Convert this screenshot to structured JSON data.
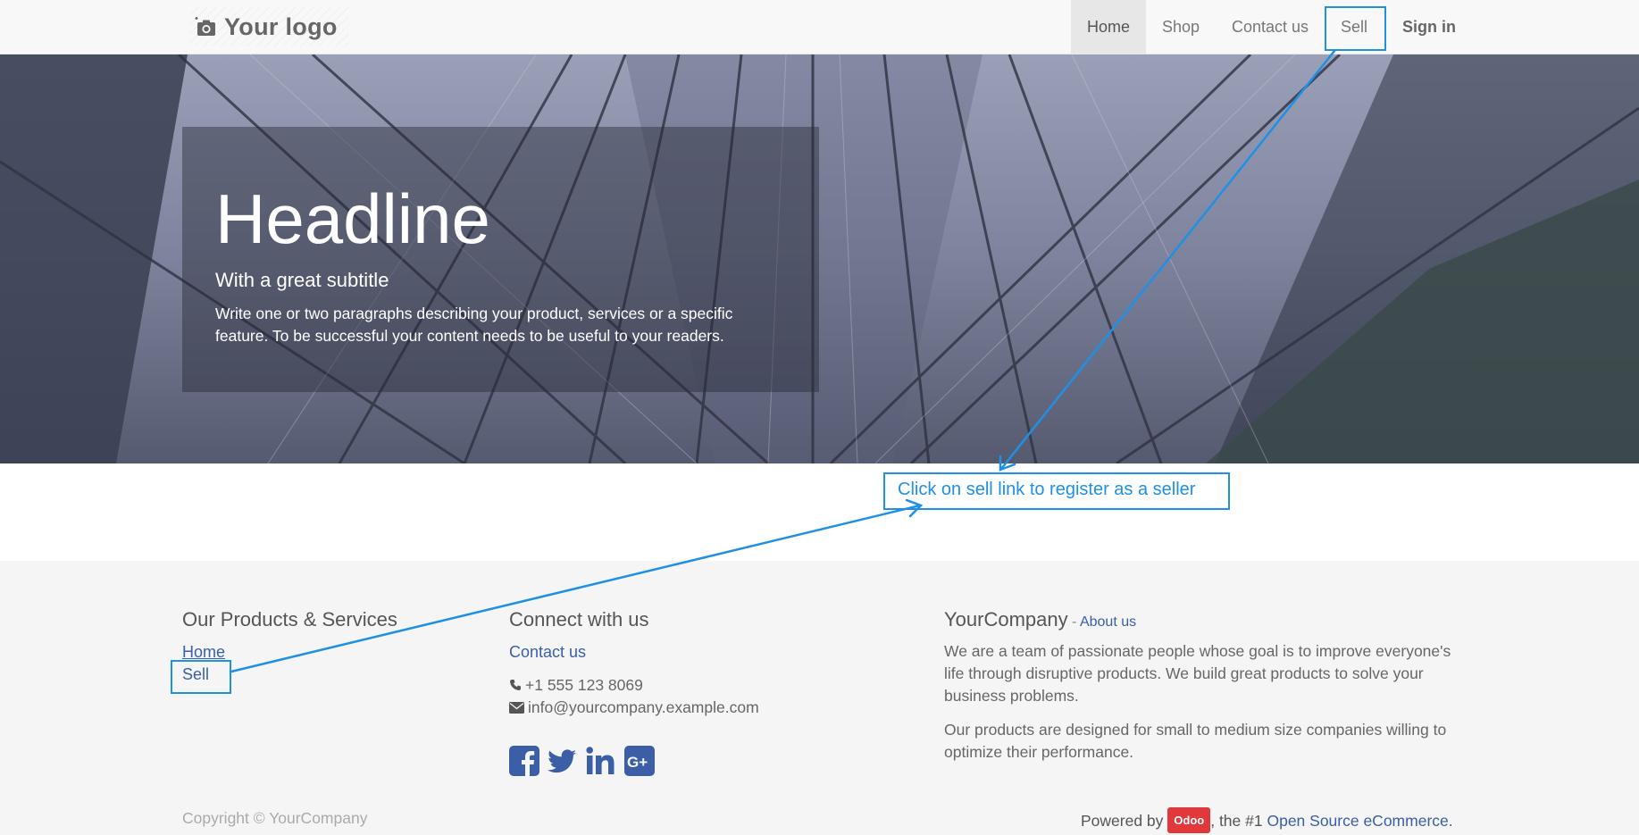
{
  "navbar": {
    "logo_text": "Your logo",
    "items": [
      {
        "label": "Home"
      },
      {
        "label": "Shop"
      },
      {
        "label": "Contact us"
      },
      {
        "label": "Sell"
      },
      {
        "label": "Sign in"
      }
    ]
  },
  "hero": {
    "headline": "Headline",
    "subtitle": "With a great subtitle",
    "paragraph": "Write one or two paragraphs describing your product, services or a specific feature. To be successful your content needs to be useful to your readers."
  },
  "annotation": {
    "label": "Click on sell link to register as a seller",
    "color": "#1e90e6"
  },
  "footer": {
    "products": {
      "heading": "Our Products & Services",
      "links": [
        "Home",
        "Sell"
      ]
    },
    "connect": {
      "heading": "Connect with us",
      "contact_link": "Contact us",
      "phone": "+1 555 123 8069",
      "email": "info@yourcompany.example.com",
      "social_icons": [
        "facebook-icon",
        "twitter-icon",
        "linkedin-icon",
        "google-plus-icon"
      ]
    },
    "company": {
      "name": "YourCompany",
      "separator": " - ",
      "about_link": "About us",
      "para1": "We are a team of passionate people whose goal is to improve everyone's life through disruptive products. We build great products to solve your business problems.",
      "para2": "Our products are designed for small to medium size companies willing to optimize their performance."
    },
    "copyright": "Copyright © YourCompany",
    "powered_prefix": "Powered by ",
    "powered_badge": "Odoo",
    "powered_middle": ", the #1 ",
    "powered_link": "Open Source eCommerce",
    "powered_suffix": "."
  },
  "colors": {
    "link": "#3b5ea7",
    "annotation": "#1e90e6",
    "badge": "#e0383b"
  }
}
